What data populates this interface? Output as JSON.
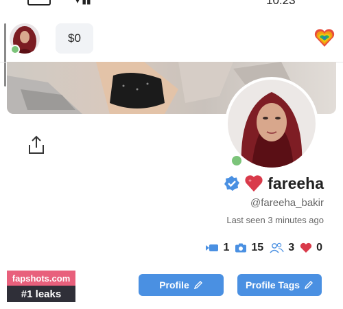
{
  "status_bar": {
    "signal": "▾ ▮▮",
    "time": "10:23"
  },
  "header": {
    "balance": "$0",
    "pride_icon": "rainbow-heart-icon"
  },
  "profile": {
    "name": "fareeha",
    "name_emoji_icon": "red-heart-icon",
    "verified_icon": "verified-badge-icon",
    "handle": "@fareeha_bakir",
    "last_seen": "Last seen 3 minutes ago",
    "online": true
  },
  "stats": [
    {
      "icon": "heart-icon",
      "value": "0"
    },
    {
      "icon": "fans-icon",
      "value": "3"
    },
    {
      "icon": "camera-icon",
      "value": "15"
    },
    {
      "icon": "video-icon",
      "value": "1"
    }
  ],
  "buttons": {
    "profile_tags": "Profile Tags",
    "profile": "Profile"
  },
  "watermark": {
    "site": "fapshots.com",
    "tagline": "#1 leaks"
  },
  "colors": {
    "accent": "#4a90e2",
    "online": "#7cc47a",
    "heart": "#d93a4a",
    "watermark_pink": "#e8607c"
  }
}
